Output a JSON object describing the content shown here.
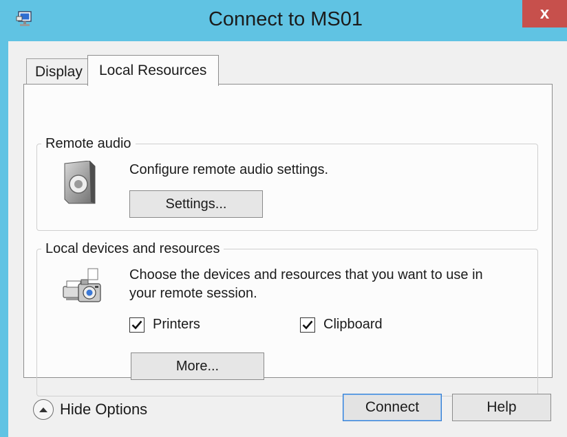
{
  "window": {
    "title": "Connect to MS01",
    "close_label": "x"
  },
  "tabs": [
    {
      "label": "Display",
      "active": false
    },
    {
      "label": "Local Resources",
      "active": true
    }
  ],
  "remote_audio": {
    "heading": "Remote audio",
    "description": "Configure remote audio settings.",
    "settings_button": "Settings..."
  },
  "local_devices": {
    "heading": "Local devices and resources",
    "description_line1": "Choose the devices and resources that you want to use in",
    "description_line2": "your remote session.",
    "checkboxes": [
      {
        "label": "Printers",
        "checked": true
      },
      {
        "label": "Clipboard",
        "checked": true
      }
    ],
    "more_button": "More..."
  },
  "footer": {
    "hide_options_label": "Hide Options",
    "connect_button": "Connect",
    "help_button": "Help"
  }
}
